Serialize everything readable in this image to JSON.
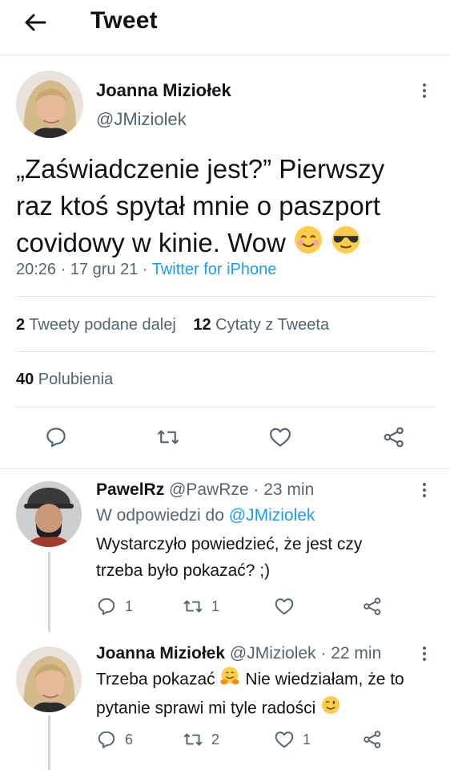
{
  "header": {
    "title": "Tweet"
  },
  "tweet": {
    "author_name": "Joanna Miziołek",
    "author_handle": "@JMiziolek",
    "text_line1": "„Zaświadczenie jest?” Pierwszy",
    "text_line2": "raz ktoś spytał mnie o paszport",
    "text_line3": "covidowy w kinie. Wow",
    "time": "20:26 · 17 gru 21 · ",
    "source": "Twitter for iPhone",
    "retweets_count": "2",
    "retweets_label": " Tweety podane dalej",
    "quotes_count": "12",
    "quotes_label": " Cytaty z Tweeta",
    "likes_count": "40",
    "likes_label": " Polubienia"
  },
  "replies": [
    {
      "name": "PawelRz",
      "handle": "@PawRze",
      "time": " · 23 min",
      "reply_to_label": "W odpowiedzi do ",
      "reply_to_handle": "@JMiziolek",
      "text_line1": "Wystarczyło powiedzieć, że jest czy",
      "text_line2": "trzeba było pokazać? ;)",
      "reply_count": "1",
      "retweet_count": "1",
      "like_count": ""
    },
    {
      "name": "Joanna Miziołek",
      "handle": "@JMiziolek",
      "time": " · 22 min",
      "text_line1a": "Trzeba pokazać",
      "text_line1b": "Nie wiedziałam, że to",
      "text_line2": "pytanie sprawi mi tyle radości",
      "reply_count": "6",
      "retweet_count": "2",
      "like_count": "1"
    }
  ],
  "icons": {
    "back": "arrow-left-icon",
    "more": "more-vertical-icon",
    "reply": "reply-icon",
    "retweet": "retweet-icon",
    "like": "heart-icon",
    "share": "share-icon"
  },
  "colors": {
    "link": "#1d9bf0",
    "secondary_text": "#536471",
    "divider": "#e4e6e8"
  }
}
